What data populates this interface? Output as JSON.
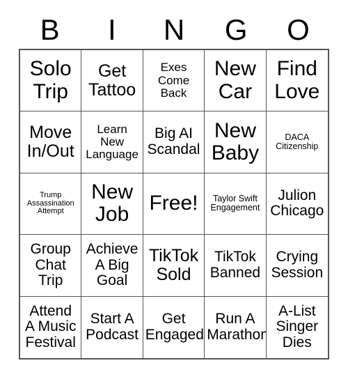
{
  "card": {
    "title": "BINGO",
    "header_letters": [
      "B",
      "I",
      "N",
      "G",
      "O"
    ],
    "free_space_label": "Free!",
    "columns": 5,
    "rows": 5,
    "border_color": "#555555",
    "text_color": "#000000",
    "background_color": "#ffffff",
    "cells": [
      {
        "text": "Solo\nTrip",
        "size": "xl",
        "free": false
      },
      {
        "text": "Get\nTattoo",
        "size": "lg",
        "free": false
      },
      {
        "text": "Exes\nCome\nBack",
        "size": "sm",
        "free": false
      },
      {
        "text": "New\nCar",
        "size": "xl",
        "free": false
      },
      {
        "text": "Find\nLove",
        "size": "xl",
        "free": false
      },
      {
        "text": "Move\nIn/Out",
        "size": "lg",
        "free": false
      },
      {
        "text": "Learn\nNew\nLanguage",
        "size": "sm",
        "free": false
      },
      {
        "text": "Big AI\nScandal",
        "size": "md",
        "free": false
      },
      {
        "text": "New\nBaby",
        "size": "xl",
        "free": false
      },
      {
        "text": "DACA\nCitizenship",
        "size": "xs",
        "free": false
      },
      {
        "text": "Trump\nAssassination\nAttempt",
        "size": "xxs",
        "free": false
      },
      {
        "text": "New\nJob",
        "size": "xl",
        "free": false
      },
      {
        "text": "Free!",
        "size": "xl",
        "free": true
      },
      {
        "text": "Taylor Swift\nEngagement",
        "size": "xs",
        "free": false
      },
      {
        "text": "Julion\nChicago",
        "size": "md",
        "free": false
      },
      {
        "text": "Group\nChat\nTrip",
        "size": "md",
        "free": false
      },
      {
        "text": "Achieve\nA Big\nGoal",
        "size": "md",
        "free": false
      },
      {
        "text": "TikTok\nSold",
        "size": "lg",
        "free": false
      },
      {
        "text": "TikTok\nBanned",
        "size": "md",
        "free": false
      },
      {
        "text": "Crying\nSession",
        "size": "md",
        "free": false
      },
      {
        "text": "Attend\nA Music\nFestival",
        "size": "md",
        "free": false
      },
      {
        "text": "Start A\nPodcast",
        "size": "md",
        "free": false
      },
      {
        "text": "Get\nEngaged",
        "size": "md",
        "free": false
      },
      {
        "text": "Run A\nMarathon",
        "size": "md",
        "free": false
      },
      {
        "text": "A-List\nSinger\nDies",
        "size": "md",
        "free": false
      }
    ]
  }
}
